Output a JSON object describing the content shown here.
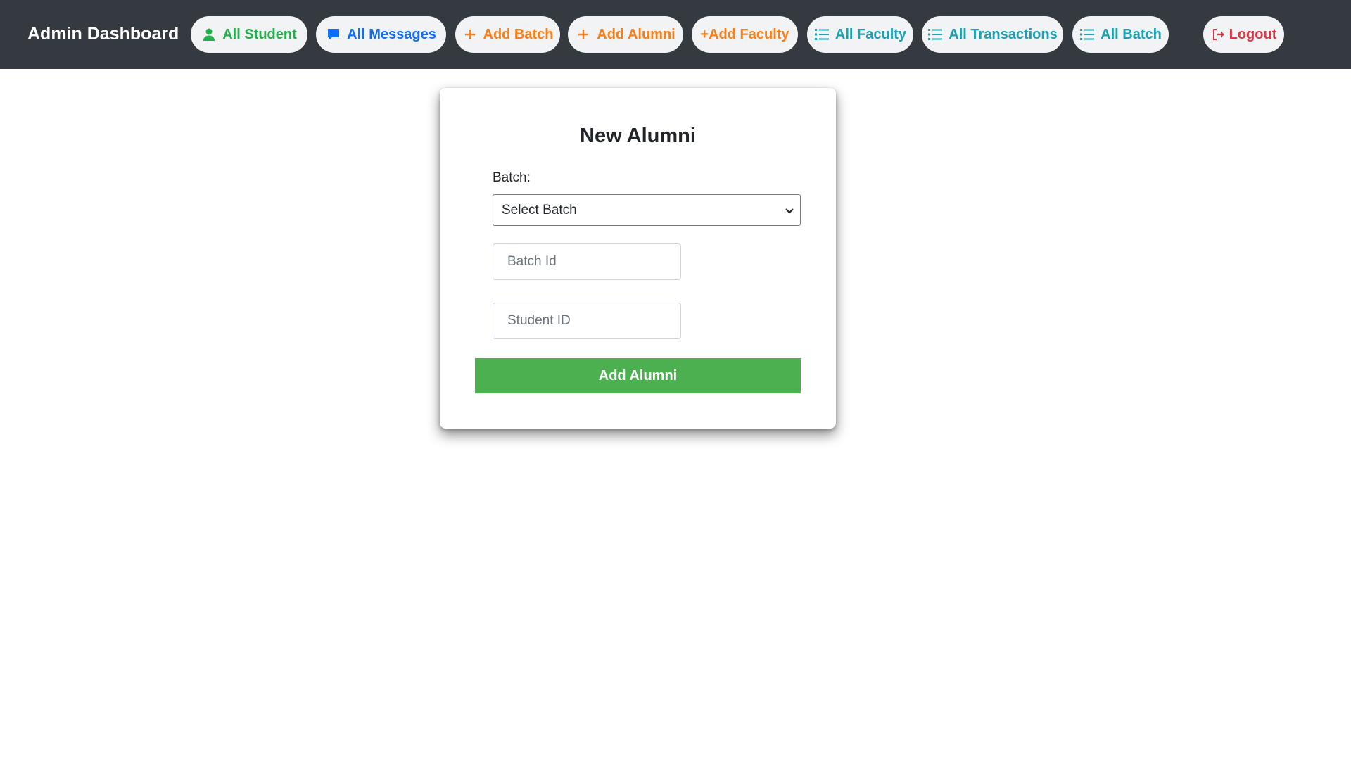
{
  "navbar": {
    "brand": "Admin Dashboard",
    "links": [
      {
        "label": "All Student",
        "icon": "user-icon",
        "color": "#21b14a"
      },
      {
        "label": "All Messages",
        "icon": "message-icon",
        "color": "#0d6efd"
      },
      {
        "label": "Add Batch",
        "icon": "plus-icon",
        "color": "#fd7e14"
      },
      {
        "label": "Add Alumni",
        "icon": "plus-icon",
        "color": "#fd7e14"
      },
      {
        "label": "+Add Faculty",
        "color": "#fd7e14"
      },
      {
        "label": "All Faculty",
        "icon": "list-icon",
        "color": "#17a2b8"
      },
      {
        "label": "All Transactions",
        "icon": "list-icon",
        "color": "#17a2b8"
      },
      {
        "label": "All Batch",
        "icon": "list-icon",
        "color": "#17a2b8"
      }
    ],
    "logout": {
      "label": "Logout",
      "icon": "sign-out-icon",
      "color": "#dc3545"
    }
  },
  "form": {
    "title": "New Alumni",
    "batch_label": "Batch:",
    "batch_select": {
      "selected": "Select Batch"
    },
    "batch_id_placeholder": "Batch Id",
    "student_id_placeholder": "Student ID",
    "submit_label": "Add Alumni",
    "submit_color": "#4caf50"
  }
}
